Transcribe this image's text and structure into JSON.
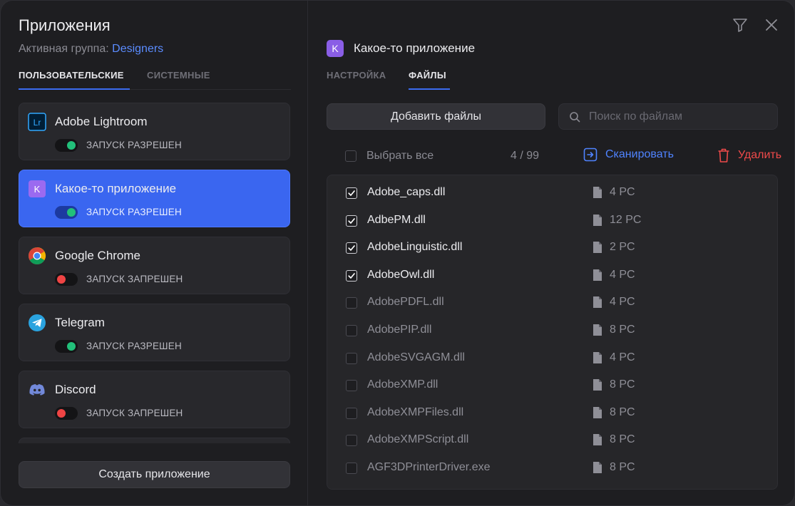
{
  "left": {
    "title": "Приложения",
    "group_label": "Активная группа:",
    "group_name": "Designers",
    "tabs": [
      {
        "label": "ПОЛЬЗОВАТЕЛЬСКИЕ",
        "active": true
      },
      {
        "label": "СИСТЕМНЫЕ",
        "active": false
      }
    ],
    "apps": [
      {
        "name": "Adobe Lightroom",
        "status": "ЗАПУСК РАЗРЕШЕН",
        "allowed": true,
        "icon": "lightroom-icon",
        "selected": false
      },
      {
        "name": "Какое-то приложение",
        "status": "ЗАПУСК РАЗРЕШЕН",
        "allowed": true,
        "icon": "k-app-icon",
        "selected": true
      },
      {
        "name": "Google Chrome",
        "status": "ЗАПУСК ЗАПРЕШЕН",
        "allowed": false,
        "icon": "chrome-icon",
        "selected": false
      },
      {
        "name": "Telegram",
        "status": "ЗАПУСК РАЗРЕШЕН",
        "allowed": true,
        "icon": "telegram-icon",
        "selected": false
      },
      {
        "name": "Discord",
        "status": "ЗАПУСК ЗАПРЕШЕН",
        "allowed": false,
        "icon": "discord-icon",
        "selected": false
      }
    ],
    "create_button": "Создать приложение"
  },
  "right": {
    "app_badge": "K",
    "app_name": "Какое-то приложение",
    "tabs": [
      {
        "label": "НАСТРОЙКА",
        "active": false
      },
      {
        "label": "ФАЙЛЫ",
        "active": true
      }
    ],
    "add_files_button": "Добавить файлы",
    "search_placeholder": "Поиск по файлам",
    "select_all_label": "Выбрать все",
    "selected_count": "4 / 99",
    "scan_label": "Сканировать",
    "delete_label": "Удалить",
    "files": [
      {
        "name": "Adobe_caps.dll",
        "size": "4 PC",
        "checked": true
      },
      {
        "name": "AdbePM.dll",
        "size": "12 PC",
        "checked": true
      },
      {
        "name": "AdobeLinguistic.dll",
        "size": "2 PC",
        "checked": true
      },
      {
        "name": "AdobeOwl.dll",
        "size": "4 PC",
        "checked": true
      },
      {
        "name": "AdobePDFL.dll",
        "size": "4 PC",
        "checked": false
      },
      {
        "name": "AdobePIP.dll",
        "size": "8 PC",
        "checked": false
      },
      {
        "name": "AdobeSVGAGM.dll",
        "size": "4 PC",
        "checked": false
      },
      {
        "name": "AdobeXMP.dll",
        "size": "8 PC",
        "checked": false
      },
      {
        "name": "AdobeXMPFiles.dll",
        "size": "8 PC",
        "checked": false
      },
      {
        "name": "AdobeXMPScript.dll",
        "size": "8 PC",
        "checked": false
      },
      {
        "name": "AGF3DPrinterDriver.exe",
        "size": "8 PC",
        "checked": false
      }
    ]
  },
  "colors": {
    "accent": "#3a66f0",
    "link": "#5b8cff",
    "allowed": "#22c07a",
    "denied": "#ef4444",
    "delete": "#ef4a4a"
  }
}
